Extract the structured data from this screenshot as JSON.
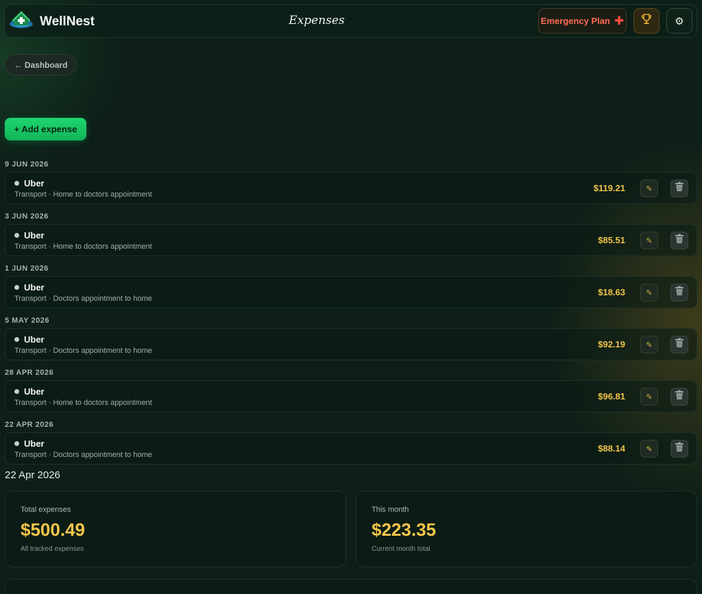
{
  "header": {
    "brand": "WellNest",
    "title": "Expenses",
    "emergency_label": "Emergency Plan",
    "emergency_icon": "plus-icon",
    "trophy_icon": "trophy-icon",
    "settings_icon": "gear-icon"
  },
  "nav": {
    "back_label": "← Dashboard",
    "add_label": "+ Add expense"
  },
  "expense_groups": [
    {
      "date": "9 JUN 2026",
      "title": "Uber",
      "subtitle": "Transport · Home to doctors appointment",
      "amount": "$119.21"
    },
    {
      "date": "3 JUN 2026",
      "title": "Uber",
      "subtitle": "Transport · Home to doctors appointment",
      "amount": "$85.51"
    },
    {
      "date": "1 JUN 2026",
      "title": "Uber",
      "subtitle": "Transport · Doctors appointment to home",
      "amount": "$18.63"
    },
    {
      "date": "5 MAY 2026",
      "title": "Uber",
      "subtitle": "Transport · Doctors appointment to home",
      "amount": "$92.19"
    },
    {
      "date": "28 APR 2026",
      "title": "Uber",
      "subtitle": "Transport · Home to doctors appointment",
      "amount": "$96.81"
    },
    {
      "date": "22 APR 2026",
      "title": "Uber",
      "subtitle": "Transport · Doctors appointment to home",
      "amount": "$88.14"
    }
  ],
  "footer_date": "22 Apr 2026",
  "stats": {
    "total": {
      "label": "Total expenses",
      "value": "$500.49",
      "note": "All tracked expenses"
    },
    "month": {
      "label": "This month",
      "value": "$223.35",
      "note": "Current month total"
    }
  },
  "colors": {
    "background": "#0d1f18",
    "accent_green": "#1ed66e",
    "amount_gold": "#f0c24a",
    "emergency_red": "#ff6b55"
  }
}
